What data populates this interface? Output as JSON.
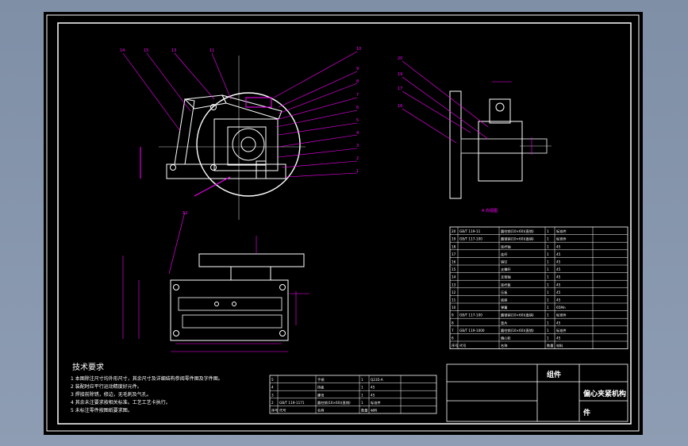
{
  "tech_requirements": {
    "title": "技术要求",
    "items": [
      "1 本图除注尺寸均外形尺寸，其余尺寸及详细结构参阅零件图及字件图。",
      "2 装配时应平行运动精度好元件。",
      "3 焊接前除锈，修边，无毛刺及气孔。",
      "4 其余未注要求按相关标准。工艺工艺卡执行。",
      "5 未标注零件按图纸要求图。"
    ]
  },
  "parts_table": {
    "rows": [
      {
        "no": "20",
        "code": "GB/T 119-11",
        "name": "圆柱销(10×60)(直销)",
        "qty": "1",
        "mat": "标准件"
      },
      {
        "no": "19",
        "code": "GB/T 117-100",
        "name": "圆锥销(10×60)(直销)",
        "qty": "1",
        "mat": "标准件"
      },
      {
        "no": "18",
        "code": "",
        "name": "连杆轴",
        "qty": "1",
        "mat": "45"
      },
      {
        "no": "17",
        "code": "",
        "name": "连杆",
        "qty": "1",
        "mat": "45"
      },
      {
        "no": "16",
        "code": "",
        "name": "销钉",
        "qty": "1",
        "mat": "45"
      },
      {
        "no": "15",
        "code": "",
        "name": "支撑杆",
        "qty": "1",
        "mat": "45"
      },
      {
        "no": "14",
        "code": "",
        "name": "支架轴",
        "qty": "1",
        "mat": "45"
      },
      {
        "no": "13",
        "code": "",
        "name": "连杆板",
        "qty": "1",
        "mat": "45"
      },
      {
        "no": "12",
        "code": "",
        "name": "压板",
        "qty": "1",
        "mat": "45"
      },
      {
        "no": "11",
        "code": "",
        "name": "底座",
        "qty": "1",
        "mat": "45"
      },
      {
        "no": "10",
        "code": "",
        "name": "弹簧",
        "qty": "1",
        "mat": "65Mn"
      },
      {
        "no": "9",
        "code": "GB/T 117-100",
        "name": "圆锥销(10×60)(直销)",
        "qty": "1",
        "mat": "标准件"
      },
      {
        "no": "8",
        "code": "",
        "name": "垫片",
        "qty": "1",
        "mat": "45"
      },
      {
        "no": "7",
        "code": "GB/T 119-1000",
        "name": "圆柱销(10×60)(直销)",
        "qty": "1",
        "mat": "标准件"
      },
      {
        "no": "6",
        "code": "",
        "name": "偏心轮",
        "qty": "1",
        "mat": "45"
      }
    ],
    "header": {
      "no": "序号",
      "code": "代号",
      "name": "名称",
      "qty": "数量",
      "mat": "材料"
    }
  },
  "lower_table": {
    "rows": [
      {
        "no": "5",
        "code": "",
        "name": "手柄",
        "qty": "1",
        "mat": "Q235-A"
      },
      {
        "no": "4",
        "code": "",
        "name": "挡板",
        "qty": "1",
        "mat": "45"
      },
      {
        "no": "3",
        "code": "",
        "name": "螺母",
        "qty": "1",
        "mat": "45"
      },
      {
        "no": "2",
        "code": "GB/T 119-1171",
        "name": "圆柱销(10×60)(直销)",
        "qty": "1",
        "mat": "标准件"
      }
    ],
    "header": {
      "no": "序号",
      "code": "代号",
      "name": "名称",
      "qty": "数量",
      "mat": "材料"
    }
  },
  "title_block": {
    "main_title": "组件",
    "drawing_name": "偏心夹紧机构",
    "part_label": "件"
  },
  "view_label": "A 向视图",
  "balloons_front": [
    "14",
    "15",
    "13",
    "11",
    "10",
    "9",
    "8",
    "7",
    "6",
    "5",
    "4",
    "3",
    "2",
    "1",
    "12"
  ],
  "balloons_side": [
    "20",
    "19",
    "17",
    "16"
  ],
  "colors": {
    "outline": "#ffffff",
    "annotation": "#ff00ff",
    "background": "#000000",
    "page": "#8795ab"
  }
}
